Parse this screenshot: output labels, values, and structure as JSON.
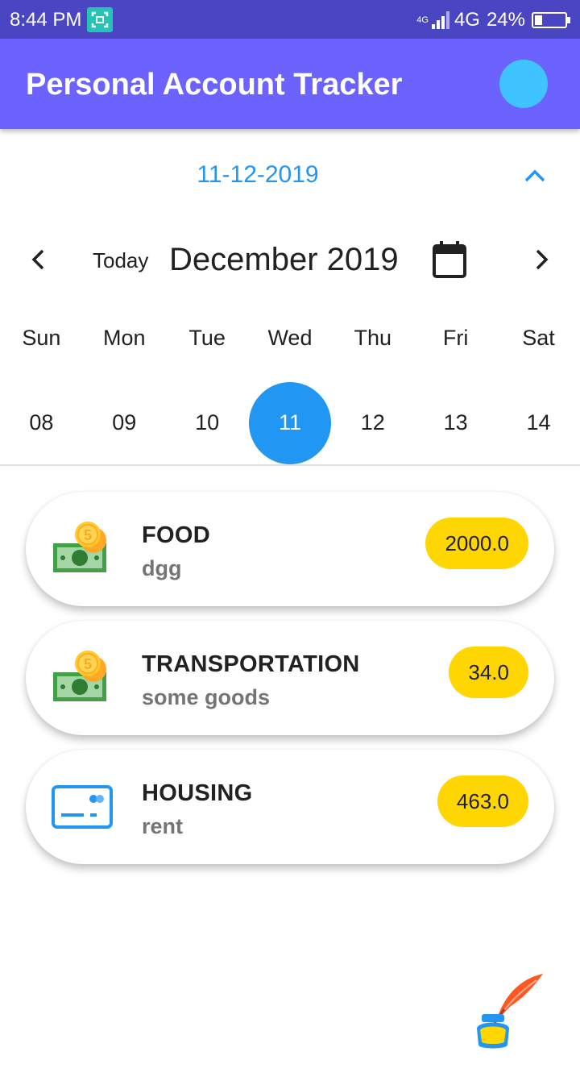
{
  "status_bar": {
    "time": "8:44 PM",
    "network_small": "4G",
    "network": "4G",
    "battery": "24%"
  },
  "app_bar": {
    "title": "Personal Account Tracker",
    "avatar_color": "#40c4ff",
    "bar_color": "#6c63ff"
  },
  "calendar": {
    "selected_date": "11-12-2019",
    "today_label": "Today",
    "month_label": "December 2019",
    "weekdays": [
      "Sun",
      "Mon",
      "Tue",
      "Wed",
      "Thu",
      "Fri",
      "Sat"
    ],
    "dates": [
      "08",
      "09",
      "10",
      "11",
      "12",
      "13",
      "14"
    ],
    "selected_index": 3,
    "accent_color": "#2196f3"
  },
  "expenses": [
    {
      "category": "FOOD",
      "note": "dgg",
      "amount": "2000.0",
      "icon": "cash-coins-icon"
    },
    {
      "category": "TRANSPORTATION",
      "note": "some goods",
      "amount": "34.0",
      "icon": "cash-coins-icon"
    },
    {
      "category": "HOUSING",
      "note": "rent",
      "amount": "463.0",
      "icon": "credit-card-icon"
    }
  ],
  "amount_color": "#ffd600",
  "fab": {
    "icon": "quill-ink-icon"
  }
}
